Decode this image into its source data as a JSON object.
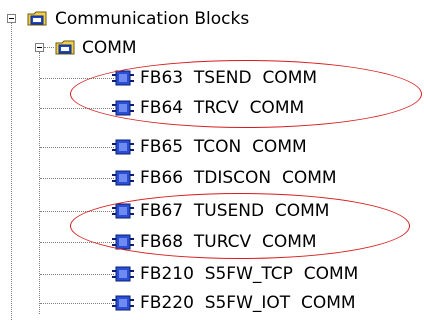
{
  "tree": {
    "root": {
      "label": "Communication Blocks",
      "icon": "folder-icon",
      "expanded": true
    },
    "group": {
      "label": "COMM",
      "icon": "folder-icon",
      "expanded": true
    },
    "blocks": [
      {
        "id": "FB63",
        "name": "TSEND",
        "family": "COMM",
        "icon": "function-block-icon",
        "highlighted": true
      },
      {
        "id": "FB64",
        "name": "TRCV",
        "family": "COMM",
        "icon": "function-block-icon",
        "highlighted": true
      },
      {
        "id": "FB65",
        "name": "TCON",
        "family": "COMM",
        "icon": "function-block-icon",
        "highlighted": false
      },
      {
        "id": "FB66",
        "name": "TDISCON",
        "family": "COMM",
        "icon": "function-block-icon",
        "highlighted": false
      },
      {
        "id": "FB67",
        "name": "TUSEND",
        "family": "COMM",
        "icon": "function-block-icon",
        "highlighted": true
      },
      {
        "id": "FB68",
        "name": "TURCV",
        "family": "COMM",
        "icon": "function-block-icon",
        "highlighted": true
      },
      {
        "id": "FB210",
        "name": "S5FW_TCP",
        "family": "COMM",
        "icon": "function-block-icon",
        "highlighted": false
      },
      {
        "id": "FB220",
        "name": "S5FW_IOT",
        "family": "COMM",
        "icon": "function-block-icon",
        "highlighted": false
      }
    ]
  },
  "colors": {
    "highlight_ellipse": "#d81c1c",
    "connector": "#808080",
    "block_icon_blue": "#2a4fd6",
    "folder_yellow": "#f2d04a"
  }
}
